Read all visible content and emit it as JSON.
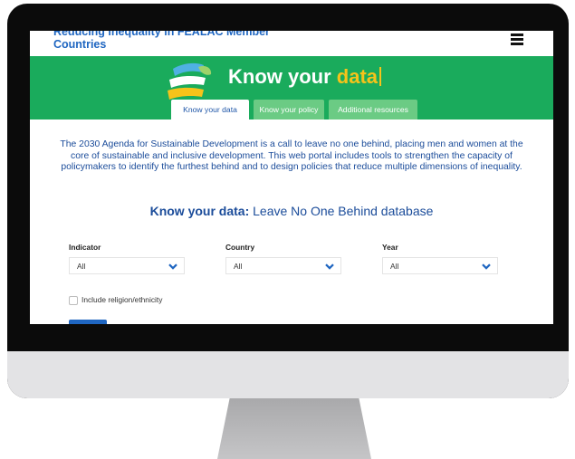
{
  "site": {
    "title": "Reducing inequality in FEALAC Member Countries"
  },
  "banner": {
    "title_main": "Know your ",
    "title_accent": "data"
  },
  "tabs": [
    {
      "label": "Know your data",
      "active": true
    },
    {
      "label": "Know your policy",
      "active": false
    },
    {
      "label": "Additional resources",
      "active": false
    }
  ],
  "intro": {
    "text": "The 2030 Agenda for Sustainable Development is a call to leave no one behind, placing men and women at the core of sustainable and inclusive development. This web portal includes tools to strengthen the capacity of policymakers to identify the furthest behind and to design policies that reduce multiple dimensions of inequality."
  },
  "section": {
    "heading_bold": "Know your data:",
    "heading_rest": " Leave No One Behind database"
  },
  "filters": {
    "indicator": {
      "label": "Indicator",
      "value": "All"
    },
    "country": {
      "label": "Country",
      "value": "All"
    },
    "year": {
      "label": "Year",
      "value": "All"
    }
  },
  "options": {
    "religion_label": "Include religion/ethnicity",
    "religion_checked": false
  },
  "colors": {
    "brand_green": "#1aab5c",
    "tab_inactive": "#6bcb84",
    "accent_yellow": "#f6c31a",
    "link_blue": "#1f66c1",
    "text_blue": "#1b4c9a"
  },
  "icons": [
    "menu-icon",
    "logo-icon",
    "chevron-down-icon"
  ]
}
